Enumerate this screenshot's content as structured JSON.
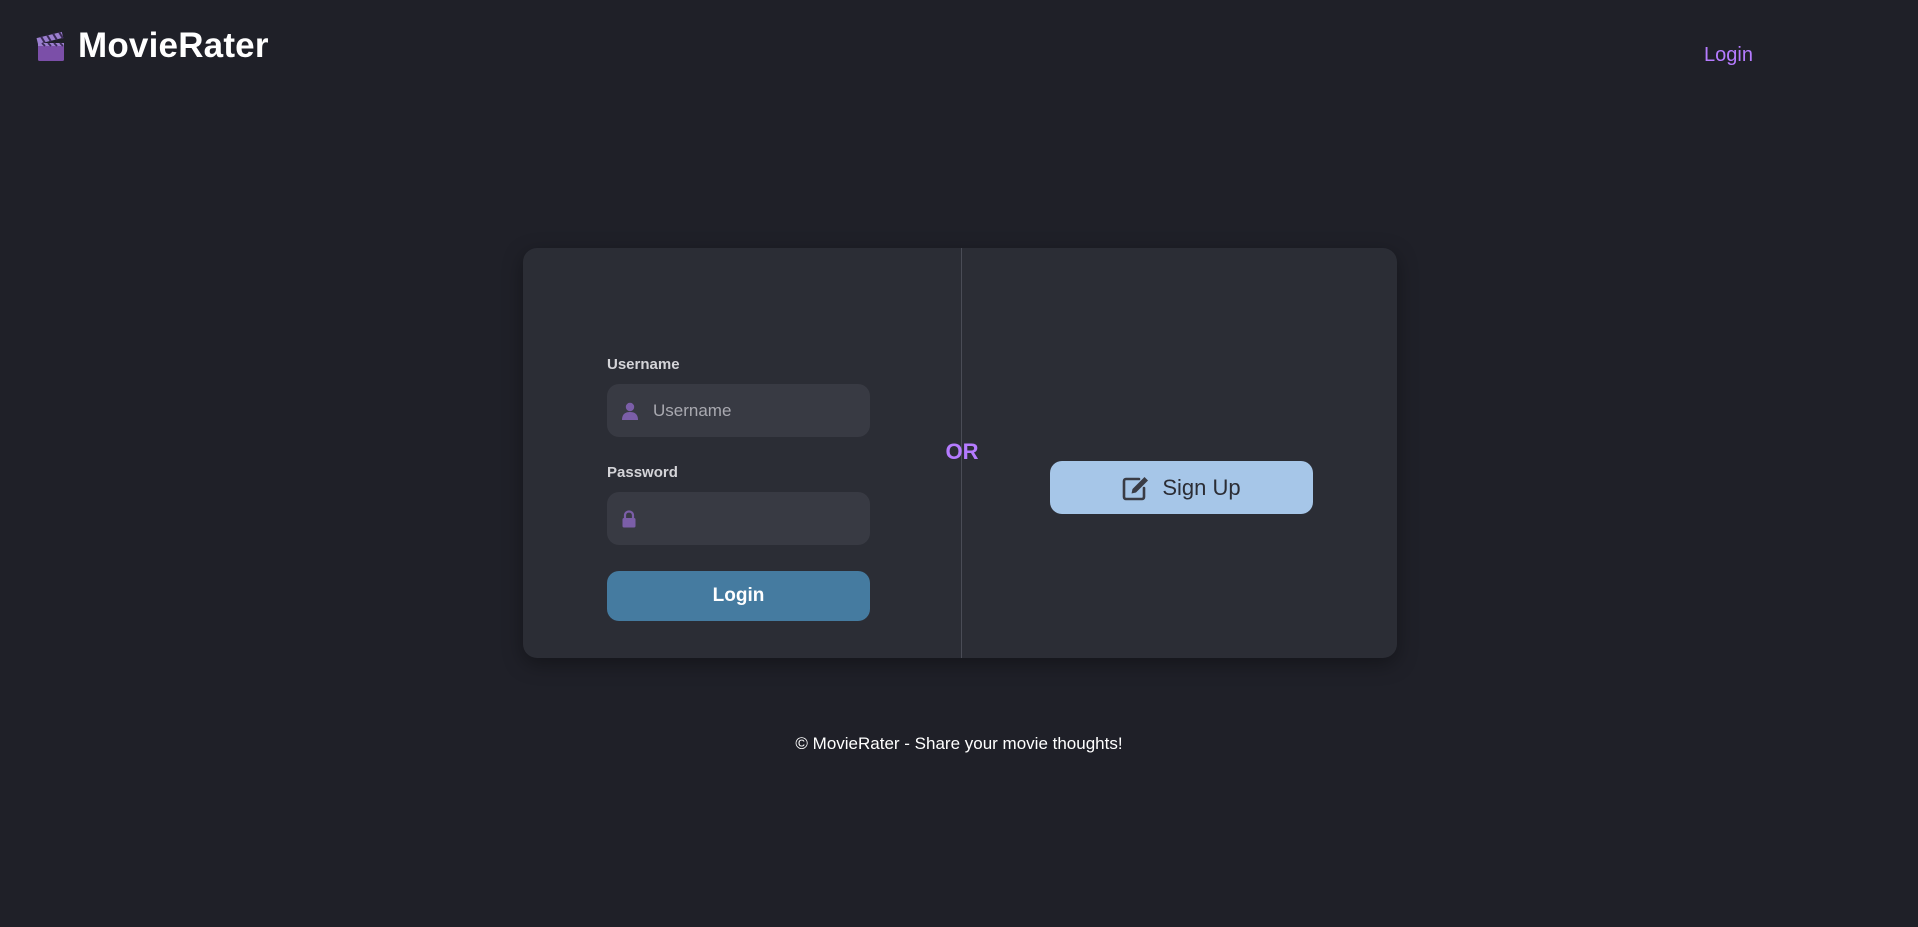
{
  "header": {
    "brand_name": "MovieRater",
    "brand_icon": "clapperboard-icon",
    "nav": {
      "login_label": "Login"
    }
  },
  "login_form": {
    "username_label": "Username",
    "username_placeholder": "Username",
    "username_value": "",
    "username_icon": "user-icon",
    "password_label": "Password",
    "password_value": "",
    "password_icon": "lock-icon",
    "submit_label": "Login"
  },
  "separator": {
    "label": "OR"
  },
  "signup": {
    "label": "Sign Up",
    "icon": "edit-icon"
  },
  "footer": {
    "text": "© MovieRater - Share your movie thoughts!"
  },
  "colors": {
    "background": "#1f2028",
    "card": "#2b2d35",
    "accent": "#b57bff",
    "login_button": "#457ba0",
    "signup_button": "#a6c6e8"
  }
}
